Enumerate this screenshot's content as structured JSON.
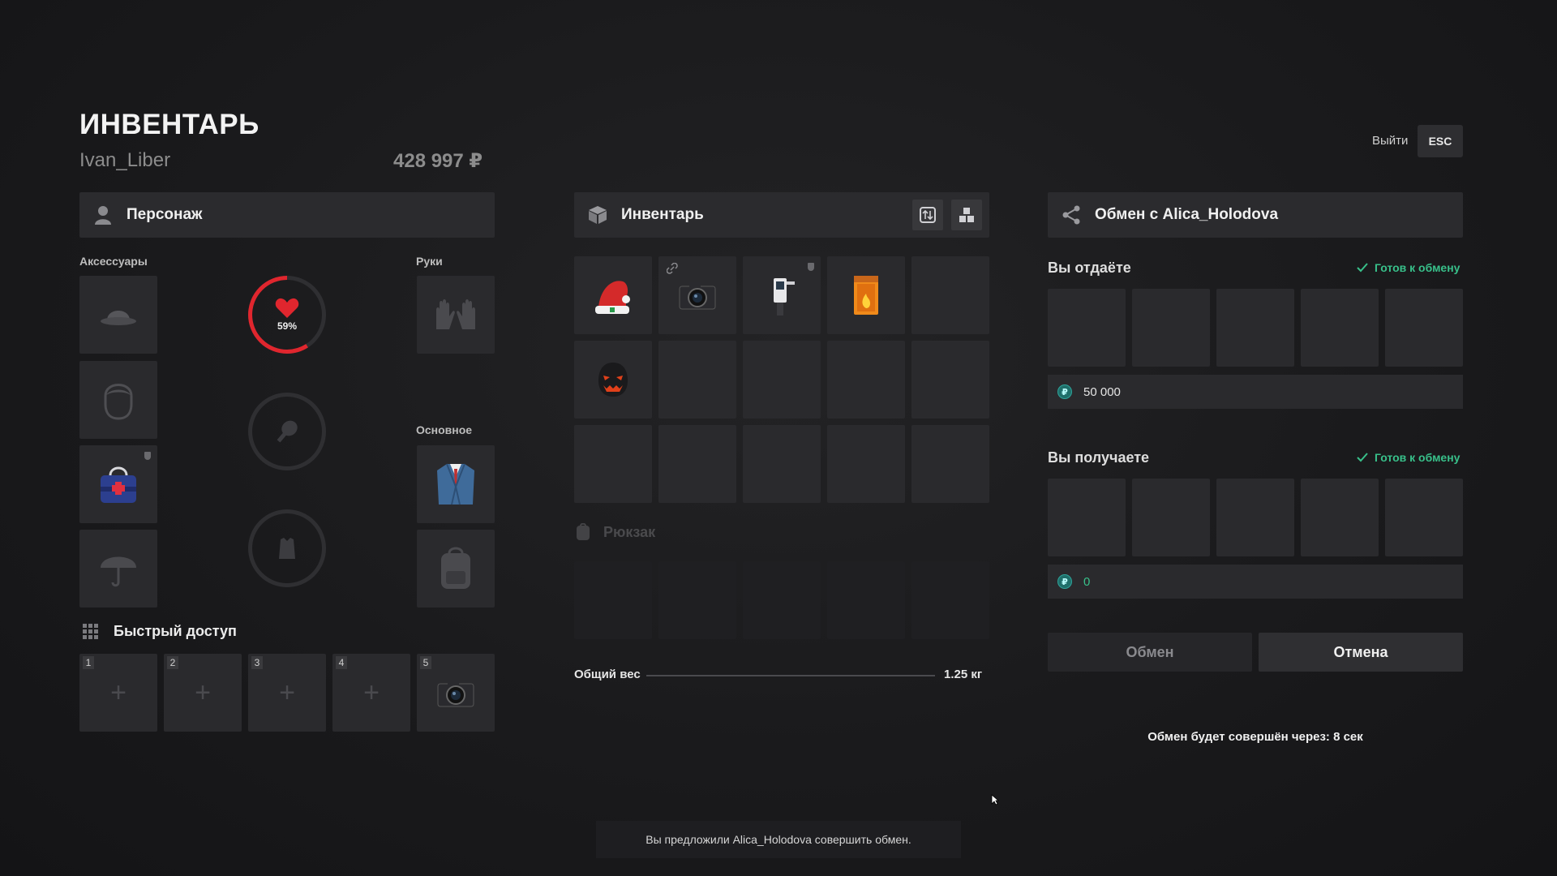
{
  "header": {
    "title": "ИНВЕНТАРЬ",
    "player_name": "Ivan_Liber",
    "balance": "428 997 ₽",
    "exit_label": "Выйти",
    "esc_label": "ESC"
  },
  "character": {
    "title": "Персонаж",
    "accessories_label": "Аксессуары",
    "hands_label": "Руки",
    "main_label": "Основное",
    "health_percent": 59,
    "health_label": "59%"
  },
  "quick_access": {
    "title": "Быстрый доступ",
    "slots": [
      {
        "num": "1",
        "item": "empty"
      },
      {
        "num": "2",
        "item": "empty"
      },
      {
        "num": "3",
        "item": "empty"
      },
      {
        "num": "4",
        "item": "empty"
      },
      {
        "num": "5",
        "item": "camera"
      }
    ]
  },
  "inventory": {
    "title": "Инвентарь",
    "items": [
      "santa-hat",
      "camera",
      "radiation-meter",
      "matches",
      "",
      "pumpkin-mask",
      "",
      "",
      "",
      "",
      "",
      "",
      "",
      "",
      ""
    ],
    "backpack_label": "Рюкзак",
    "weight_label": "Общий вес",
    "weight_value": "1.25 кг"
  },
  "trade": {
    "title": "Обмен с Alica_Holodova",
    "give_title": "Вы отдаёте",
    "receive_title": "Вы получаете",
    "ready_label_give": "Готов к обмену",
    "ready_label_receive": "Готов к обмену",
    "give_money": "50 000",
    "receive_money": "0",
    "currency_symbol": "₽",
    "exchange_button": "Обмен",
    "cancel_button": "Отмена",
    "countdown": "Обмен будет совершён через: 8 сек"
  },
  "notification": "Вы предложили Alica_Holodova совершить обмен.",
  "colors": {
    "accent_green": "#38c08a",
    "health_red": "#e0262e",
    "panel": "#2b2b2e"
  }
}
